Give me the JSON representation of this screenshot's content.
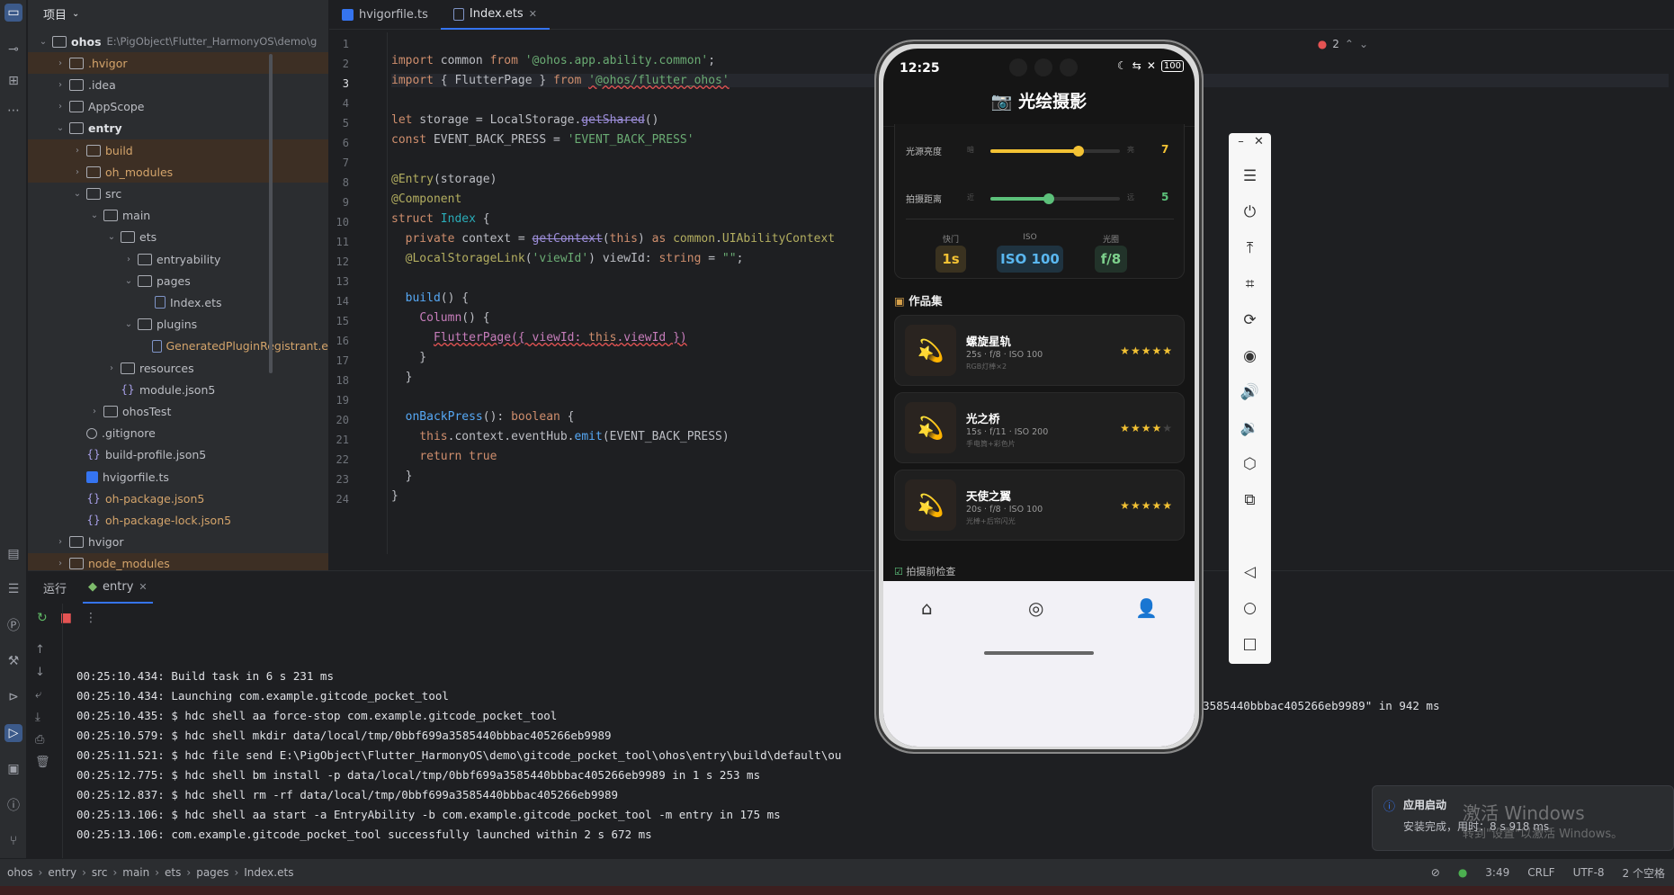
{
  "project_panel": {
    "title": "项目",
    "tree": [
      {
        "label": "ohos",
        "path": "E:\\PigObject\\Flutter_HarmonyOS\\demo\\g",
        "level": 0
      },
      {
        "label": ".hvigor",
        "level": 1
      },
      {
        "label": ".idea",
        "level": 1
      },
      {
        "label": "AppScope",
        "level": 1
      },
      {
        "label": "entry",
        "level": 1
      },
      {
        "label": "build",
        "level": 2
      },
      {
        "label": "oh_modules",
        "level": 2
      },
      {
        "label": "src",
        "level": 2
      },
      {
        "label": "main",
        "level": 3
      },
      {
        "label": "ets",
        "level": 4
      },
      {
        "label": "entryability",
        "level": 5
      },
      {
        "label": "pages",
        "level": 5
      },
      {
        "label": "Index.ets",
        "level": 6
      },
      {
        "label": "plugins",
        "level": 5
      },
      {
        "label": "GeneratedPluginRegistrant.e",
        "level": 6
      },
      {
        "label": "resources",
        "level": 4
      },
      {
        "label": "module.json5",
        "level": 4
      },
      {
        "label": "ohosTest",
        "level": 3
      },
      {
        "label": ".gitignore",
        "level": 2
      },
      {
        "label": "build-profile.json5",
        "level": 2
      },
      {
        "label": "hvigorfile.ts",
        "level": 2
      },
      {
        "label": "oh-package.json5",
        "level": 2
      },
      {
        "label": "oh-package-lock.json5",
        "level": 2
      },
      {
        "label": "hvigor",
        "level": 1
      },
      {
        "label": "node_modules",
        "level": 1
      }
    ]
  },
  "editor": {
    "tabs": [
      {
        "label": "hvigorfile.ts"
      },
      {
        "label": "Index.ets"
      }
    ],
    "error_count": "2",
    "line_numbers": [
      "1",
      "2",
      "3",
      "4",
      "5",
      "6",
      "7",
      "8",
      "9",
      "10",
      "11",
      "12",
      "13",
      "14",
      "15",
      "16",
      "17",
      "18",
      "19",
      "20",
      "21",
      "22",
      "23",
      "24"
    ]
  },
  "run_panel": {
    "title": "运行",
    "config": "entry",
    "logs": [
      "00:25:10.434: Build task in 6 s 231 ms",
      "00:25:10.434: Launching com.example.gitcode_pocket_tool",
      "00:25:10.435: $ hdc shell aa force-stop com.example.gitcode_pocket_tool",
      "00:25:10.579: $ hdc shell mkdir data/local/tmp/0bbf699a3585440bbbac405266eb9989",
      "00:25:11.521: $ hdc file send E:\\PigObject\\Flutter_HarmonyOS\\demo\\gitcode_pocket_tool\\ohos\\entry\\build\\default\\ou",
      "00:25:12.775: $ hdc shell bm install -p data/local/tmp/0bbf699a3585440bbbac405266eb9989 in 1 s 253 ms",
      "00:25:12.837: $ hdc shell rm -rf data/local/tmp/0bbf699a3585440bbbac405266eb9989",
      "00:25:13.106: $ hdc shell aa start -a EntryAbility -b com.example.gitcode_pocket_tool -m entry in 175 ms",
      "00:25:13.106: com.example.gitcode_pocket_tool successfully launched within 2 s 672 ms"
    ],
    "log_tail": "data/local/tmp/0bbf699a3585440bbbac405266eb9989\" in 942 ms"
  },
  "status_bar": {
    "breadcrumb": [
      "ohos",
      "entry",
      "src",
      "main",
      "ets",
      "pages",
      "Index.ets"
    ],
    "position": "3:49",
    "line_ending": "CRLF",
    "encoding": "UTF-8",
    "indent": "2 个空格"
  },
  "phone": {
    "time": "12:25",
    "battery": "100",
    "app_title": "光绘摄影",
    "sliders": [
      {
        "label": "光源亮度",
        "min_label": "暗",
        "max_label": "亮",
        "value": "7",
        "fraction": 0.68,
        "color": "#f3c234"
      },
      {
        "label": "拍摄距离",
        "min_label": "近",
        "max_label": "远",
        "value": "5",
        "fraction": 0.45,
        "color": "#5cc07a"
      }
    ],
    "settings": [
      {
        "label": "快门",
        "value": "1s",
        "color": "#f3c234",
        "bg": "#3a3220"
      },
      {
        "label": "ISO",
        "value": "ISO 100",
        "color": "#5ab7f0",
        "bg": "#1f3340"
      },
      {
        "label": "光圈",
        "value": "f/8",
        "color": "#7dd08c",
        "bg": "#22332a"
      }
    ],
    "gallery_title": "作品集",
    "works": [
      {
        "title": "螺旋星轨",
        "meta": "25s · f/8 · ISO 100",
        "tool": "RGB灯棒×2",
        "rating": 5
      },
      {
        "title": "光之桥",
        "meta": "15s · f/11 · ISO 200",
        "tool": "手电筒+彩色片",
        "rating": 4
      },
      {
        "title": "天使之翼",
        "meta": "20s · f/8 · ISO 100",
        "tool": "光棒+后帘闪光",
        "rating": 5
      }
    ],
    "checklist_title": "拍摄前检查"
  },
  "notification": {
    "title": "应用启动",
    "body": "安装完成，用时：8 s 918 ms",
    "watermark_line1": "激活 Windows",
    "watermark_line2": "转到\"设置\"以激活 Windows。"
  }
}
